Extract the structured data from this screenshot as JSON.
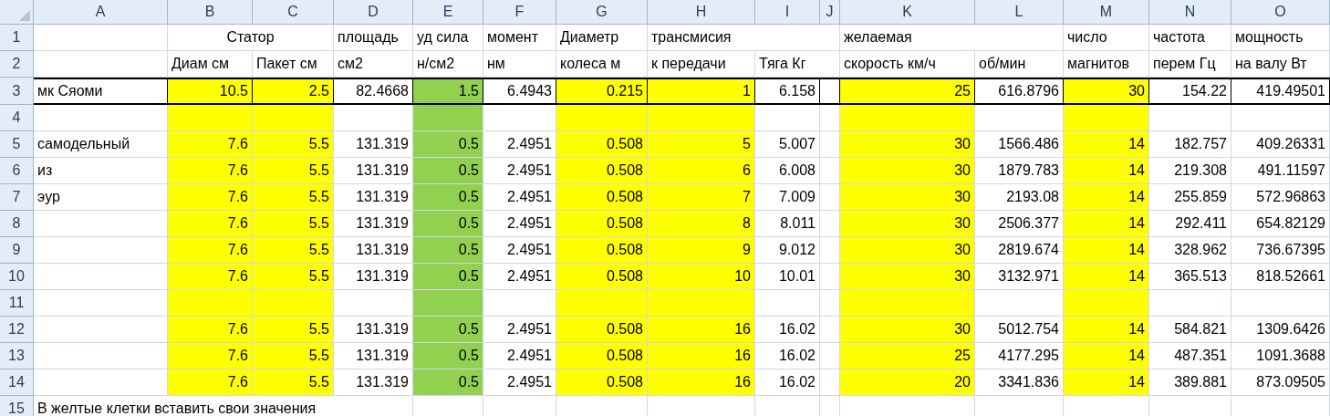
{
  "columns": [
    {
      "letter": "A"
    },
    {
      "letter": "B",
      "color": "#ffff00"
    },
    {
      "letter": "C",
      "color": "#ffff00"
    },
    {
      "letter": "D"
    },
    {
      "letter": "E",
      "color": "#92d050"
    },
    {
      "letter": "F"
    },
    {
      "letter": "G",
      "color": "#ffff00"
    },
    {
      "letter": "H",
      "color": "#ffff00"
    },
    {
      "letter": "I"
    },
    {
      "letter": "J"
    },
    {
      "letter": "K",
      "color": "#ffff00"
    },
    {
      "letter": "L"
    },
    {
      "letter": "M",
      "color": "#ffff00"
    },
    {
      "letter": "N"
    },
    {
      "letter": "O"
    }
  ],
  "rows": [
    {
      "number": "1",
      "kind": "labels",
      "filled": false,
      "outlined": false,
      "cells": [
        null,
        {
          "text": "Статор",
          "merged": true
        },
        null,
        "площадь",
        "уд сила",
        "момент",
        "Диаметр",
        "трансмисия",
        null,
        null,
        "желаемая",
        null,
        "число",
        "частота",
        "мощность"
      ]
    },
    {
      "number": "2",
      "kind": "labels",
      "filled": false,
      "outlined": false,
      "cells": [
        null,
        "Диам см",
        "Пакет см",
        "см2",
        "н/см2",
        "нм",
        "колеса м",
        "к передачи",
        "Тяга Кг",
        null,
        "скорость км/ч",
        "об/мин",
        "магнитов",
        "перем Гц",
        "на валу Вт"
      ]
    },
    {
      "number": "3",
      "kind": "values",
      "filled": true,
      "outlined": true,
      "cells": [
        "мк Сяоми",
        "10.5",
        "2.5",
        "82.4668",
        "1.5",
        "6.4943",
        "0.215",
        "1",
        "6.158",
        null,
        "25",
        "616.8796",
        "30",
        "154.22",
        "419.49501"
      ]
    },
    {
      "number": "4",
      "kind": "values",
      "filled": true,
      "outlined": false,
      "cells": [
        null,
        null,
        null,
        null,
        null,
        null,
        null,
        null,
        null,
        null,
        null,
        null,
        null,
        null,
        null
      ]
    },
    {
      "number": "5",
      "kind": "values",
      "filled": true,
      "outlined": false,
      "cells": [
        "самодельный",
        "7.6",
        "5.5",
        "131.319",
        "0.5",
        "2.4951",
        "0.508",
        "5",
        "5.007",
        null,
        "30",
        "1566.486",
        "14",
        "182.757",
        "409.26331"
      ]
    },
    {
      "number": "6",
      "kind": "values",
      "filled": true,
      "outlined": false,
      "cells": [
        "из",
        "7.6",
        "5.5",
        "131.319",
        "0.5",
        "2.4951",
        "0.508",
        "6",
        "6.008",
        null,
        "30",
        "1879.783",
        "14",
        "219.308",
        "491.11597"
      ]
    },
    {
      "number": "7",
      "kind": "values",
      "filled": true,
      "outlined": false,
      "cells": [
        "эур",
        "7.6",
        "5.5",
        "131.319",
        "0.5",
        "2.4951",
        "0.508",
        "7",
        "7.009",
        null,
        "30",
        "2193.08",
        "14",
        "255.859",
        "572.96863"
      ]
    },
    {
      "number": "8",
      "kind": "values",
      "filled": true,
      "outlined": false,
      "cells": [
        null,
        "7.6",
        "5.5",
        "131.319",
        "0.5",
        "2.4951",
        "0.508",
        "8",
        "8.011",
        null,
        "30",
        "2506.377",
        "14",
        "292.411",
        "654.82129"
      ]
    },
    {
      "number": "9",
      "kind": "values",
      "filled": true,
      "outlined": false,
      "cells": [
        null,
        "7.6",
        "5.5",
        "131.319",
        "0.5",
        "2.4951",
        "0.508",
        "9",
        "9.012",
        null,
        "30",
        "2819.674",
        "14",
        "328.962",
        "736.67395"
      ]
    },
    {
      "number": "10",
      "kind": "values",
      "filled": true,
      "outlined": false,
      "cells": [
        null,
        "7.6",
        "5.5",
        "131.319",
        "0.5",
        "2.4951",
        "0.508",
        "10",
        "10.01",
        null,
        "30",
        "3132.971",
        "14",
        "365.513",
        "818.52661"
      ]
    },
    {
      "number": "11",
      "kind": "values",
      "filled": true,
      "outlined": false,
      "cells": [
        null,
        null,
        null,
        null,
        null,
        null,
        null,
        null,
        null,
        null,
        null,
        null,
        null,
        null,
        null
      ]
    },
    {
      "number": "12",
      "kind": "values",
      "filled": true,
      "outlined": false,
      "cells": [
        null,
        "7.6",
        "5.5",
        "131.319",
        "0.5",
        "2.4951",
        "0.508",
        "16",
        "16.02",
        null,
        "30",
        "5012.754",
        "14",
        "584.821",
        "1309.6426"
      ]
    },
    {
      "number": "13",
      "kind": "values",
      "filled": true,
      "outlined": false,
      "cells": [
        null,
        "7.6",
        "5.5",
        "131.319",
        "0.5",
        "2.4951",
        "0.508",
        "16",
        "16.02",
        null,
        "25",
        "4177.295",
        "14",
        "487.351",
        "1091.3688"
      ]
    },
    {
      "number": "14",
      "kind": "values",
      "filled": true,
      "outlined": false,
      "cells": [
        null,
        "7.6",
        "5.5",
        "131.319",
        "0.5",
        "2.4951",
        "0.508",
        "16",
        "16.02",
        null,
        "20",
        "3341.836",
        "14",
        "389.881",
        "873.09505"
      ]
    },
    {
      "number": "15",
      "kind": "labels",
      "filled": false,
      "outlined": false,
      "cells": [
        "В желтые клетки вставить свои значения",
        null,
        null,
        null,
        null,
        null,
        null,
        null,
        null,
        null,
        null,
        null,
        null,
        null,
        null
      ]
    }
  ]
}
